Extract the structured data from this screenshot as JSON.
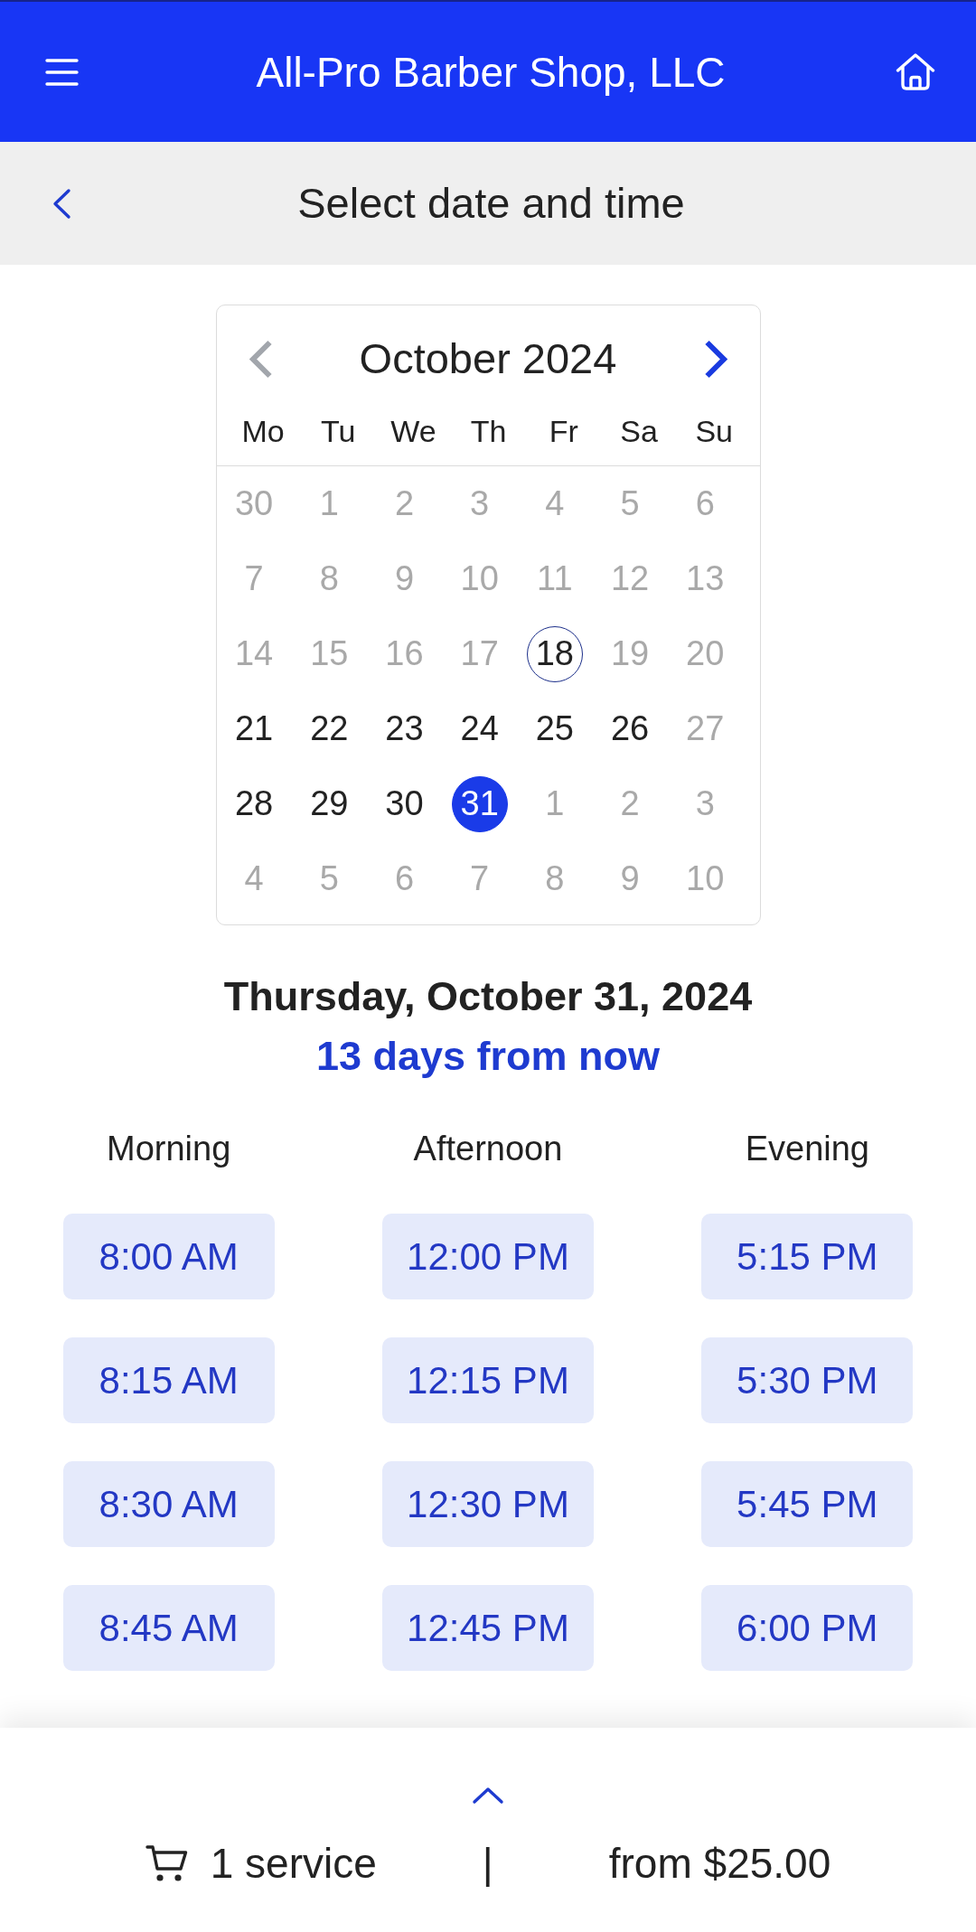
{
  "header": {
    "title": "All-Pro Barber Shop, LLC"
  },
  "subheader": {
    "title": "Select date and time"
  },
  "calendar": {
    "month": "October 2024",
    "prev_month": {
      "disabled": true
    },
    "next_month": {
      "disabled": false
    },
    "weekdays": [
      "Mo",
      "Tu",
      "We",
      "Th",
      "Fr",
      "Sa",
      "Su"
    ],
    "weeks": [
      [
        {
          "day": "30",
          "disabled": true,
          "today": false,
          "selected": false
        },
        {
          "day": "1",
          "disabled": true,
          "today": false,
          "selected": false
        },
        {
          "day": "2",
          "disabled": true,
          "today": false,
          "selected": false
        },
        {
          "day": "3",
          "disabled": true,
          "today": false,
          "selected": false
        },
        {
          "day": "4",
          "disabled": true,
          "today": false,
          "selected": false
        },
        {
          "day": "5",
          "disabled": true,
          "today": false,
          "selected": false
        },
        {
          "day": "6",
          "disabled": true,
          "today": false,
          "selected": false
        }
      ],
      [
        {
          "day": "7",
          "disabled": true,
          "today": false,
          "selected": false
        },
        {
          "day": "8",
          "disabled": true,
          "today": false,
          "selected": false
        },
        {
          "day": "9",
          "disabled": true,
          "today": false,
          "selected": false
        },
        {
          "day": "10",
          "disabled": true,
          "today": false,
          "selected": false
        },
        {
          "day": "11",
          "disabled": true,
          "today": false,
          "selected": false
        },
        {
          "day": "12",
          "disabled": true,
          "today": false,
          "selected": false
        },
        {
          "day": "13",
          "disabled": true,
          "today": false,
          "selected": false
        }
      ],
      [
        {
          "day": "14",
          "disabled": true,
          "today": false,
          "selected": false
        },
        {
          "day": "15",
          "disabled": true,
          "today": false,
          "selected": false
        },
        {
          "day": "16",
          "disabled": true,
          "today": false,
          "selected": false
        },
        {
          "day": "17",
          "disabled": true,
          "today": false,
          "selected": false
        },
        {
          "day": "18",
          "disabled": false,
          "today": true,
          "selected": false
        },
        {
          "day": "19",
          "disabled": true,
          "today": false,
          "selected": false
        },
        {
          "day": "20",
          "disabled": true,
          "today": false,
          "selected": false
        }
      ],
      [
        {
          "day": "21",
          "disabled": false,
          "today": false,
          "selected": false
        },
        {
          "day": "22",
          "disabled": false,
          "today": false,
          "selected": false
        },
        {
          "day": "23",
          "disabled": false,
          "today": false,
          "selected": false
        },
        {
          "day": "24",
          "disabled": false,
          "today": false,
          "selected": false
        },
        {
          "day": "25",
          "disabled": false,
          "today": false,
          "selected": false
        },
        {
          "day": "26",
          "disabled": false,
          "today": false,
          "selected": false
        },
        {
          "day": "27",
          "disabled": true,
          "today": false,
          "selected": false
        }
      ],
      [
        {
          "day": "28",
          "disabled": false,
          "today": false,
          "selected": false
        },
        {
          "day": "29",
          "disabled": false,
          "today": false,
          "selected": false
        },
        {
          "day": "30",
          "disabled": false,
          "today": false,
          "selected": false
        },
        {
          "day": "31",
          "disabled": false,
          "today": false,
          "selected": true
        },
        {
          "day": "1",
          "disabled": true,
          "today": false,
          "selected": false
        },
        {
          "day": "2",
          "disabled": true,
          "today": false,
          "selected": false
        },
        {
          "day": "3",
          "disabled": true,
          "today": false,
          "selected": false
        }
      ],
      [
        {
          "day": "4",
          "disabled": true,
          "today": false,
          "selected": false
        },
        {
          "day": "5",
          "disabled": true,
          "today": false,
          "selected": false
        },
        {
          "day": "6",
          "disabled": true,
          "today": false,
          "selected": false
        },
        {
          "day": "7",
          "disabled": true,
          "today": false,
          "selected": false
        },
        {
          "day": "8",
          "disabled": true,
          "today": false,
          "selected": false
        },
        {
          "day": "9",
          "disabled": true,
          "today": false,
          "selected": false
        },
        {
          "day": "10",
          "disabled": true,
          "today": false,
          "selected": false
        }
      ]
    ]
  },
  "selected_date": {
    "date": "Thursday, October 31, 2024",
    "relative": "13 days from now"
  },
  "time_slots": [
    {
      "period": "Morning",
      "slots": [
        {
          "time": "8:00 AM",
          "selected": false
        },
        {
          "time": "8:15 AM",
          "selected": false
        },
        {
          "time": "8:30 AM",
          "selected": false
        },
        {
          "time": "8:45 AM",
          "selected": false
        }
      ]
    },
    {
      "period": "Afternoon",
      "slots": [
        {
          "time": "12:00 PM",
          "selected": false
        },
        {
          "time": "12:15 PM",
          "selected": false
        },
        {
          "time": "12:30 PM",
          "selected": false
        },
        {
          "time": "12:45 PM",
          "selected": false
        }
      ]
    },
    {
      "period": "Evening",
      "slots": [
        {
          "time": "5:15 PM",
          "selected": false
        },
        {
          "time": "5:30 PM",
          "selected": false
        },
        {
          "time": "5:45 PM",
          "selected": false
        },
        {
          "time": "6:00 PM",
          "selected": false
        }
      ]
    }
  ],
  "footer": {
    "service_count": "1 service",
    "separator": "|",
    "price": "from $25.00"
  }
}
